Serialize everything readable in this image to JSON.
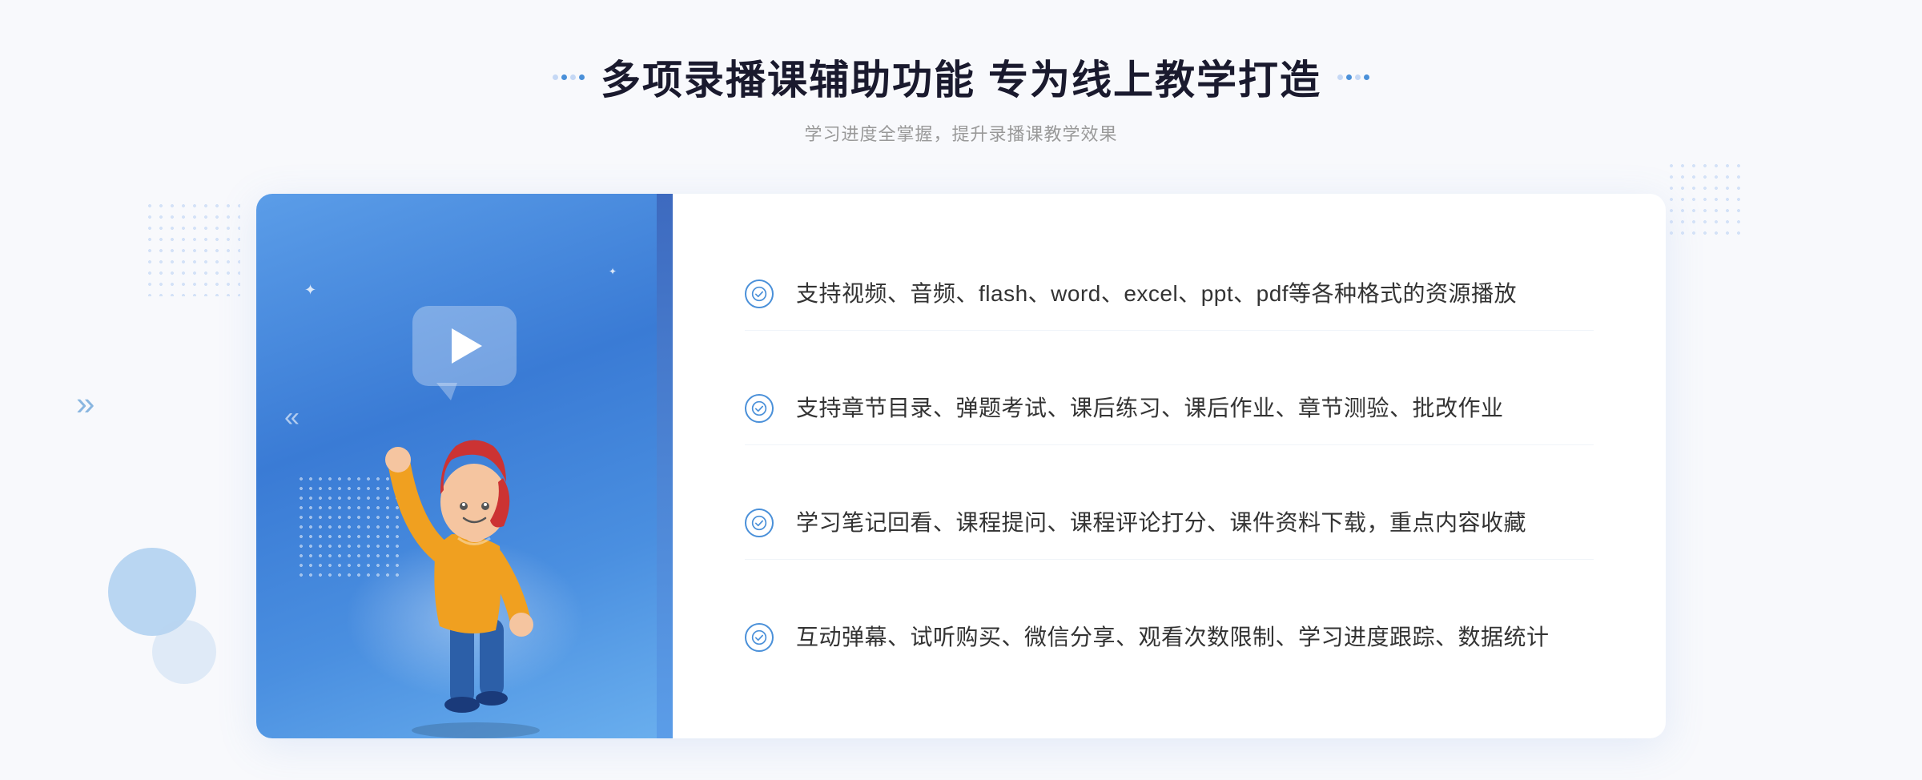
{
  "page": {
    "background": "#f8f9fc"
  },
  "header": {
    "title": "多项录播课辅助功能 专为线上教学打造",
    "subtitle": "学习进度全掌握，提升录播课教学效果",
    "title_dots_left": [
      "dot",
      "dot",
      "dot"
    ],
    "title_dots_right": [
      "dot",
      "dot",
      "dot"
    ]
  },
  "features": [
    {
      "id": "feature-1",
      "text": "支持视频、音频、flash、word、excel、ppt、pdf等各种格式的资源播放"
    },
    {
      "id": "feature-2",
      "text": "支持章节目录、弹题考试、课后练习、课后作业、章节测验、批改作业"
    },
    {
      "id": "feature-3",
      "text": "学习笔记回看、课程提问、课程评论打分、课件资料下载，重点内容收藏"
    },
    {
      "id": "feature-4",
      "text": "互动弹幕、试听购买、微信分享、观看次数限制、学习进度跟踪、数据统计"
    }
  ],
  "icons": {
    "check": "check-circle-icon",
    "play": "play-icon",
    "chevron": "chevron-right-icon"
  },
  "colors": {
    "primary": "#4a90d9",
    "title": "#1a1a2e",
    "text": "#333333",
    "subtitle": "#999999",
    "gradient_start": "#5b9de8",
    "gradient_end": "#3a7bd5"
  }
}
